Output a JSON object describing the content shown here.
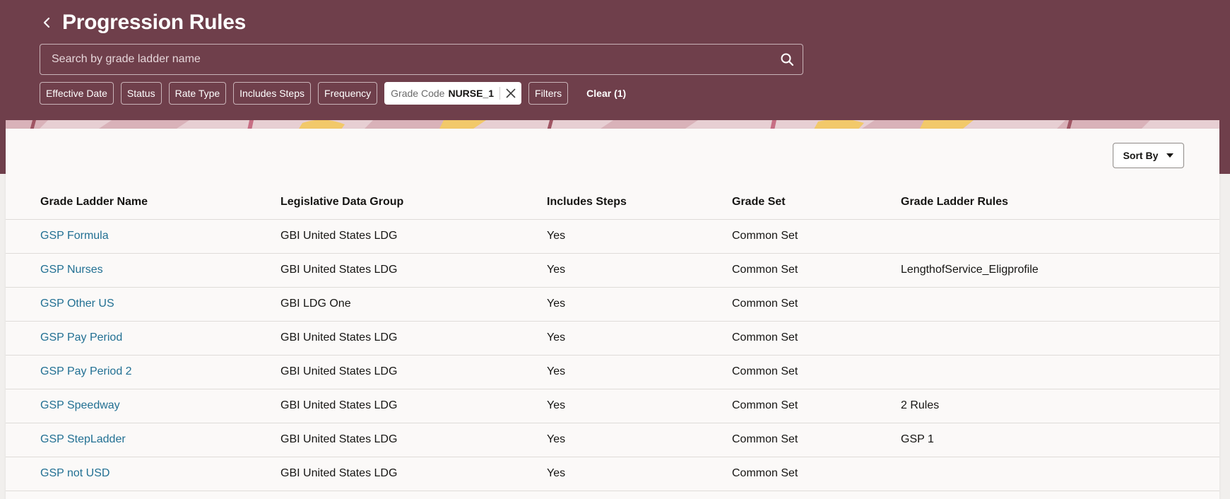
{
  "header": {
    "title": "Progression Rules",
    "back_icon": "chevron-left-icon"
  },
  "search": {
    "placeholder": "Search by grade ladder name",
    "value": "",
    "icon": "search-icon"
  },
  "filters": {
    "chips": [
      {
        "label": "Effective Date"
      },
      {
        "label": "Status"
      },
      {
        "label": "Rate Type"
      },
      {
        "label": "Includes Steps"
      },
      {
        "label": "Frequency"
      }
    ],
    "active": {
      "label": "Grade Code",
      "value": "NURSE_1"
    },
    "filters_label": "Filters",
    "clear_label": "Clear (1)"
  },
  "sort": {
    "label": "Sort By"
  },
  "table": {
    "columns": [
      "Grade Ladder Name",
      "Legislative Data Group",
      "Includes Steps",
      "Grade Set",
      "Grade Ladder Rules"
    ],
    "rows": [
      {
        "name": "GSP Formula",
        "ldg": "GBI United States LDG",
        "steps": "Yes",
        "grade_set": "Common Set",
        "rules": ""
      },
      {
        "name": "GSP Nurses",
        "ldg": "GBI United States LDG",
        "steps": "Yes",
        "grade_set": "Common Set",
        "rules": "LengthofService_Eligprofile"
      },
      {
        "name": "GSP Other US",
        "ldg": "GBI LDG One",
        "steps": "Yes",
        "grade_set": "Common Set",
        "rules": ""
      },
      {
        "name": "GSP Pay Period",
        "ldg": "GBI United States LDG",
        "steps": "Yes",
        "grade_set": "Common Set",
        "rules": ""
      },
      {
        "name": "GSP Pay Period 2",
        "ldg": "GBI United States LDG",
        "steps": "Yes",
        "grade_set": "Common Set",
        "rules": ""
      },
      {
        "name": "GSP Speedway",
        "ldg": "GBI United States LDG",
        "steps": "Yes",
        "grade_set": "Common Set",
        "rules": "2 Rules"
      },
      {
        "name": "GSP StepLadder",
        "ldg": "GBI United States LDG",
        "steps": "Yes",
        "grade_set": "Common Set",
        "rules": "GSP 1"
      },
      {
        "name": "GSP not USD",
        "ldg": "GBI United States LDG",
        "steps": "Yes",
        "grade_set": "Common Set",
        "rules": ""
      }
    ]
  },
  "colors": {
    "header_bg": "#6f3f4b",
    "link": "#227093",
    "content_bg": "#fbf9f8"
  }
}
